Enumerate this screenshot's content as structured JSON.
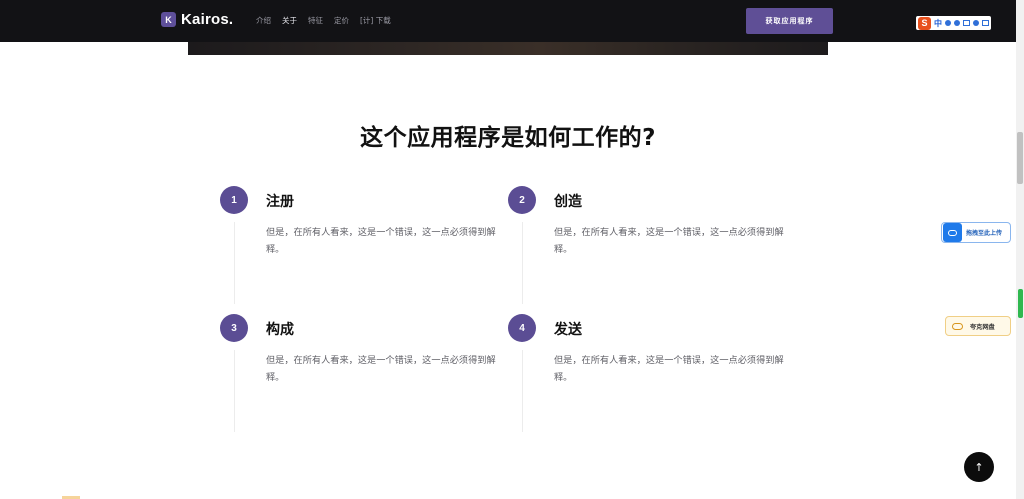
{
  "header": {
    "logo_letter": "K",
    "logo_text": "Kairos.",
    "nav": [
      {
        "label": "介绍",
        "active": false
      },
      {
        "label": "关于",
        "active": true
      },
      {
        "label": "特征",
        "active": false
      },
      {
        "label": "定价",
        "active": false
      },
      {
        "label": "[计] 下载",
        "active": false
      }
    ],
    "cta_label": "获取应用程序"
  },
  "ime": {
    "logo": "S",
    "mode": "中"
  },
  "section": {
    "title": "这个应用程序是如何工作的?",
    "steps": [
      {
        "num": "1",
        "title": "注册",
        "desc": "但是，在所有人看来，这是一个错误，这一点必须得到解释。"
      },
      {
        "num": "2",
        "title": "创造",
        "desc": "但是，在所有人看来，这是一个错误，这一点必须得到解释。"
      },
      {
        "num": "3",
        "title": "构成",
        "desc": "但是，在所有人看来，这是一个错误，这一点必须得到解释。"
      },
      {
        "num": "4",
        "title": "发送",
        "desc": "但是，在所有人看来，这是一个错误，这一点必须得到解释。"
      }
    ]
  },
  "side_widgets": {
    "upload_label": "拖拽至此上传",
    "cloud_label": "夸克网盘"
  },
  "back_to_top": "↑",
  "colors": {
    "accent": "#5b4d94",
    "topbar": "#121215",
    "cta": "#5f4f96"
  }
}
